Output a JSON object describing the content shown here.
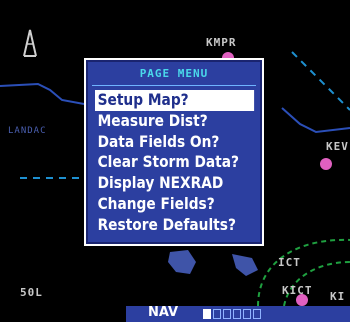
{
  "map": {
    "labels": [
      {
        "id": "kmpr",
        "text": "KMPR"
      },
      {
        "id": "landac",
        "text": "LANDAC"
      },
      {
        "id": "kev",
        "text": "KEV"
      },
      {
        "id": "ict",
        "text": "ICT"
      },
      {
        "id": "kict",
        "text": "KICT"
      },
      {
        "id": "ki",
        "text": "KI"
      },
      {
        "id": "range",
        "text": "50L"
      }
    ],
    "colors": {
      "water_border": "#2b4fb8",
      "route_dashed": "#1e90d0",
      "airspace": "#1fa040",
      "terrain": "#3f54a8",
      "airport": "#e060c0"
    }
  },
  "page_menu": {
    "title": "PAGE MENU",
    "items": [
      {
        "label": "Setup Map?",
        "selected": true
      },
      {
        "label": "Measure Dist?",
        "selected": false
      },
      {
        "label": "Data Fields On?",
        "selected": false
      },
      {
        "label": "Clear Storm Data?",
        "selected": false
      },
      {
        "label": "Display NEXRAD",
        "selected": false
      },
      {
        "label": "Change Fields?",
        "selected": false
      },
      {
        "label": "Restore Defaults?",
        "selected": false
      }
    ]
  },
  "status": {
    "mode": "NAV",
    "page_count": 6,
    "active_page": 1
  },
  "north_arrow_icon": "north-arrow-icon"
}
